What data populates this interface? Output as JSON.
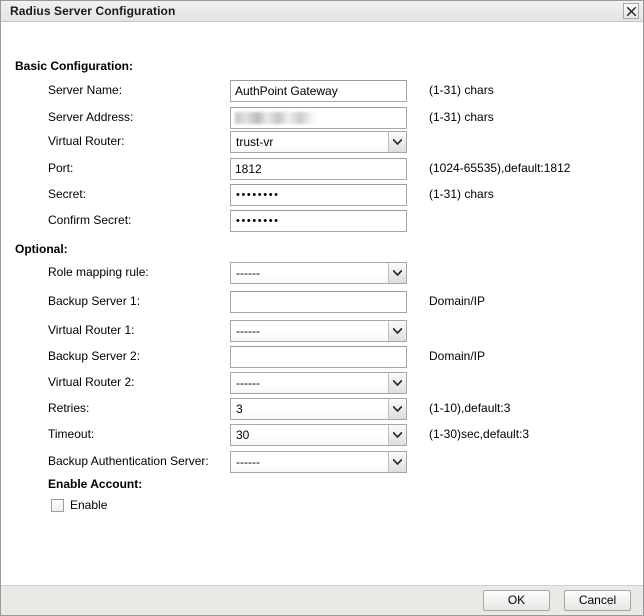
{
  "window": {
    "title": "Radius Server Configuration",
    "close_icon": "close-icon"
  },
  "sections": {
    "basic": {
      "title": "Basic Configuration:"
    },
    "optional": {
      "title": "Optional:"
    },
    "enable_account": {
      "title": "Enable Account:"
    }
  },
  "fields": {
    "server_name": {
      "label": "Server Name:",
      "value": "AuthPoint Gateway",
      "hint": "(1-31) chars"
    },
    "server_address": {
      "label": "Server Address:",
      "value": "",
      "hint": "(1-31) chars"
    },
    "virtual_router": {
      "label": "Virtual Router:",
      "value": "trust-vr",
      "hint": ""
    },
    "port": {
      "label": "Port:",
      "value": "1812",
      "hint": "(1024-65535),default:1812"
    },
    "secret": {
      "label": "Secret:",
      "value": "••••••••",
      "hint": "(1-31) chars"
    },
    "confirm_secret": {
      "label": "Confirm Secret:",
      "value": "••••••••",
      "hint": ""
    },
    "role_mapping": {
      "label": "Role mapping rule:",
      "value": "------",
      "hint": ""
    },
    "backup_server_1": {
      "label": "Backup Server 1:",
      "value": "",
      "hint": "Domain/IP"
    },
    "virtual_router_1": {
      "label": "Virtual Router 1:",
      "value": "------",
      "hint": ""
    },
    "backup_server_2": {
      "label": "Backup Server 2:",
      "value": "",
      "hint": "Domain/IP"
    },
    "virtual_router_2": {
      "label": "Virtual Router 2:",
      "value": "------",
      "hint": ""
    },
    "retries": {
      "label": "Retries:",
      "value": "3",
      "hint": "(1-10),default:3"
    },
    "timeout": {
      "label": "Timeout:",
      "value": "30",
      "hint": "(1-30)sec,default:3"
    },
    "backup_auth_server": {
      "label": "Backup Authentication Server:",
      "value": "------",
      "hint": ""
    },
    "enable_checkbox": {
      "label": "Enable",
      "checked": false
    }
  },
  "footer": {
    "ok_label": "OK",
    "cancel_label": "Cancel"
  }
}
